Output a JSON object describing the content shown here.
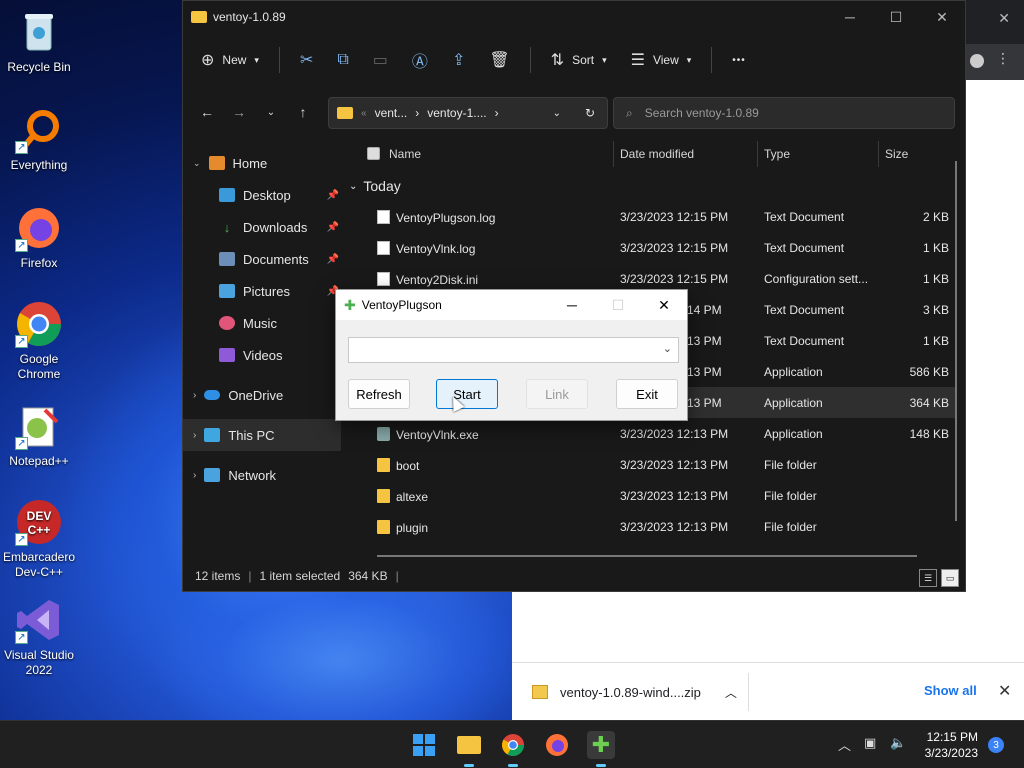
{
  "desktop": {
    "icons": [
      {
        "label": "Recycle Bin",
        "icon": "recycle-bin-icon"
      },
      {
        "label": "Everything",
        "icon": "everything-icon"
      },
      {
        "label": "Firefox",
        "icon": "firefox-icon"
      },
      {
        "label": "Google Chrome",
        "icon": "chrome-icon"
      },
      {
        "label": "Notepad++",
        "icon": "notepadpp-icon"
      },
      {
        "label": "Embarcadero Dev-C++",
        "icon": "devcpp-icon"
      },
      {
        "label": "Visual Studio 2022",
        "icon": "visual-studio-icon"
      }
    ]
  },
  "explorer": {
    "title": "ventoy-1.0.89",
    "commands": {
      "new": "New",
      "sort": "Sort",
      "view": "View",
      "more": "•••"
    },
    "address": {
      "crumb1": "vent...",
      "crumb2": "ventoy-1...."
    },
    "search_placeholder": "Search ventoy-1.0.89",
    "sidebar": [
      {
        "label": "Home",
        "icon": "home-icon",
        "pinned": false
      },
      {
        "label": "Desktop",
        "icon": "desktop-icon",
        "pinned": true
      },
      {
        "label": "Downloads",
        "icon": "downloads-icon",
        "pinned": true
      },
      {
        "label": "Documents",
        "icon": "documents-icon",
        "pinned": true
      },
      {
        "label": "Pictures",
        "icon": "pictures-icon",
        "pinned": true
      },
      {
        "label": "Music",
        "icon": "music-icon",
        "pinned": false
      },
      {
        "label": "Videos",
        "icon": "videos-icon",
        "pinned": false
      },
      {
        "label": "OneDrive",
        "icon": "onedrive-icon",
        "pinned": false
      },
      {
        "label": "This PC",
        "icon": "this-pc-icon",
        "pinned": false
      },
      {
        "label": "Network",
        "icon": "network-icon",
        "pinned": false
      }
    ],
    "columns": {
      "name": "Name",
      "date": "Date modified",
      "type": "Type",
      "size": "Size"
    },
    "group_label": "Today",
    "rows": [
      {
        "name": "VentoyPlugson.log",
        "date": "3/23/2023 12:15 PM",
        "type": "Text Document",
        "size": "2 KB",
        "kind": "doc"
      },
      {
        "name": "VentoyVlnk.log",
        "date": "3/23/2023 12:15 PM",
        "type": "Text Document",
        "size": "1 KB",
        "kind": "doc"
      },
      {
        "name": "Ventoy2Disk.ini",
        "date": "3/23/2023 12:15 PM",
        "type": "Configuration sett...",
        "size": "1 KB",
        "kind": "doc"
      },
      {
        "name": "",
        "date": "14 PM",
        "type": "Text Document",
        "size": "3 KB",
        "kind": "doc"
      },
      {
        "name": "",
        "date": "13 PM",
        "type": "Text Document",
        "size": "1 KB",
        "kind": "doc"
      },
      {
        "name": "",
        "date": "13 PM",
        "type": "Application",
        "size": "586 KB",
        "kind": "exe"
      },
      {
        "name": "",
        "date": "13 PM",
        "type": "Application",
        "size": "364 KB",
        "kind": "exe"
      },
      {
        "name": "VentoyVlnk.exe",
        "date": "3/23/2023 12:13 PM",
        "type": "Application",
        "size": "148 KB",
        "kind": "exe"
      },
      {
        "name": "boot",
        "date": "3/23/2023 12:13 PM",
        "type": "File folder",
        "size": "",
        "kind": "folder"
      },
      {
        "name": "altexe",
        "date": "3/23/2023 12:13 PM",
        "type": "File folder",
        "size": "",
        "kind": "folder"
      },
      {
        "name": "plugin",
        "date": "3/23/2023 12:13 PM",
        "type": "File folder",
        "size": "",
        "kind": "folder"
      }
    ],
    "status": {
      "count": "12 items",
      "selected": "1 item selected",
      "size": "364 KB"
    }
  },
  "dialog": {
    "title": "VentoyPlugson",
    "combo_value": "",
    "buttons": {
      "refresh": "Refresh",
      "start": "Start",
      "link": "Link",
      "exit": "Exit"
    }
  },
  "download": {
    "filename": "ventoy-1.0.89-wind....zip",
    "show_all": "Show all"
  },
  "taskbar": {
    "time": "12:15 PM",
    "date": "3/23/2023",
    "notifications": "3"
  }
}
